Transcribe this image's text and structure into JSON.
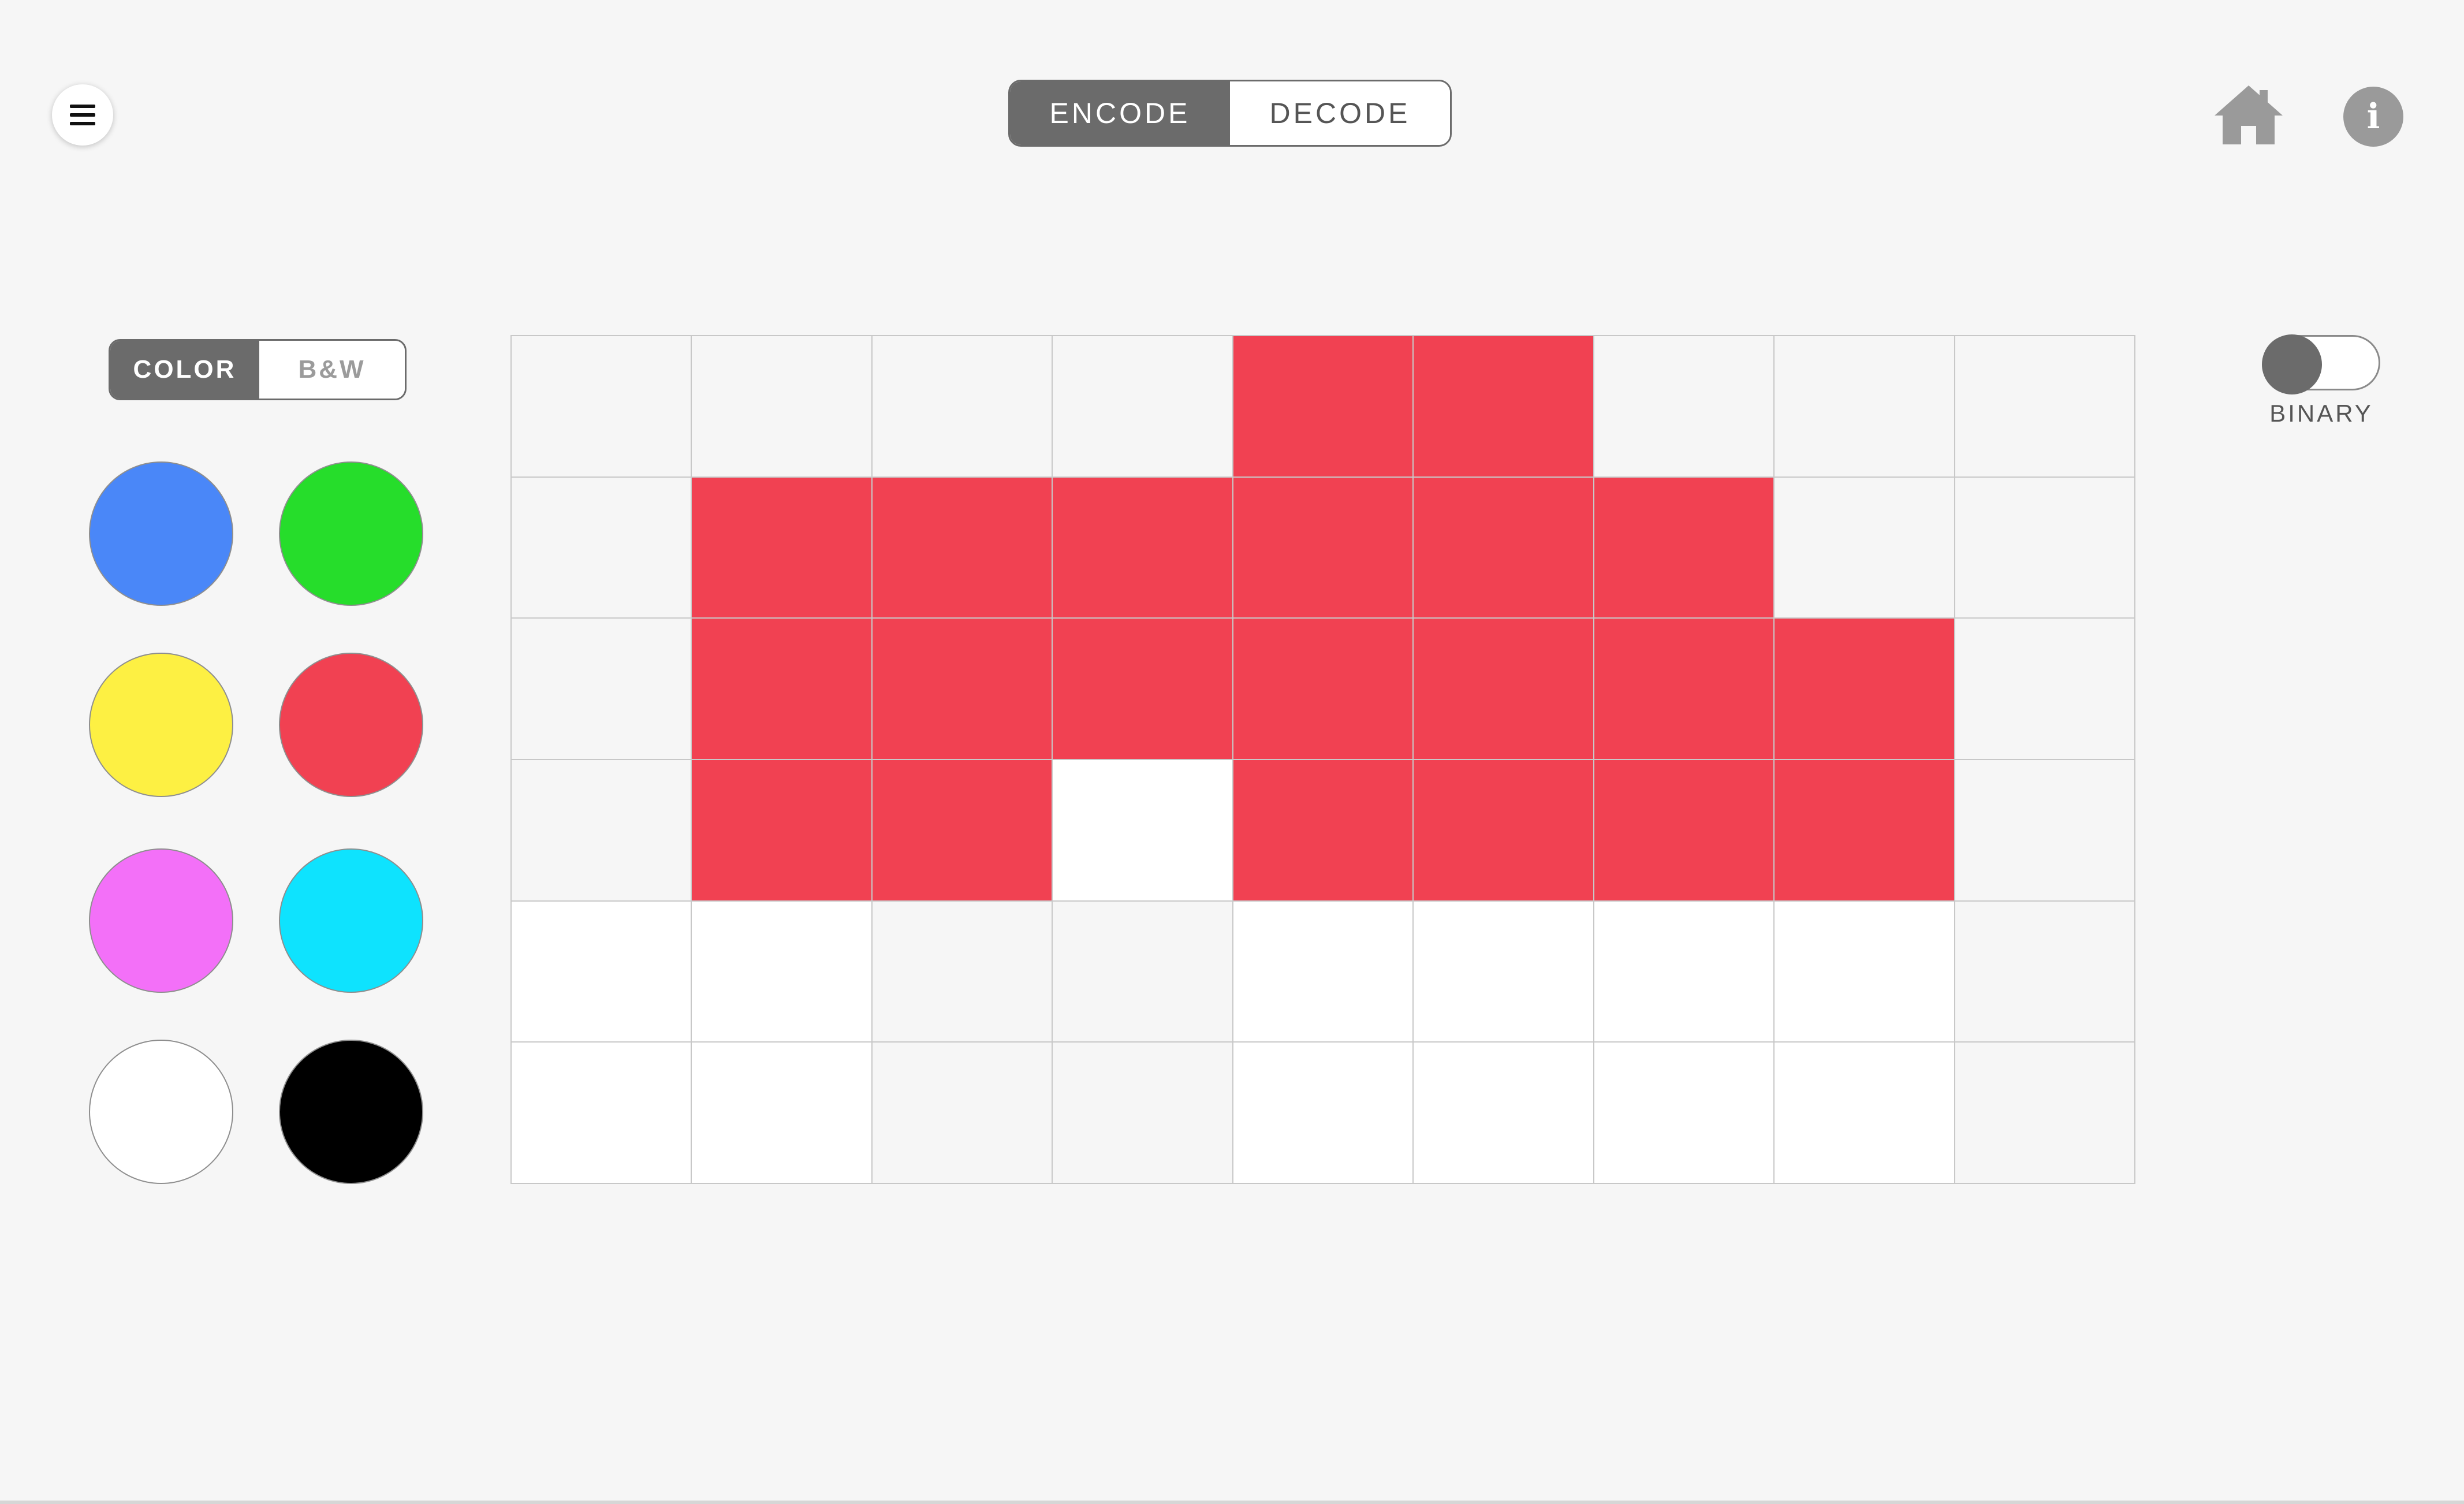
{
  "header": {
    "menu_icon": "hamburger-menu-icon",
    "mode_tabs": [
      {
        "label": "ENCODE",
        "active": true
      },
      {
        "label": "DECODE",
        "active": false
      }
    ],
    "home_icon": "home-icon",
    "info_icon": "info-icon",
    "info_glyph": "i"
  },
  "palette": {
    "mode_tabs": [
      {
        "label": "COLOR",
        "active": true
      },
      {
        "label": "B&W",
        "active": false
      }
    ],
    "swatches": [
      {
        "name": "blue",
        "color": "#4a87f8"
      },
      {
        "name": "green",
        "color": "#26dd2b"
      },
      {
        "name": "yellow",
        "color": "#fdf043"
      },
      {
        "name": "red",
        "color": "#f14152"
      },
      {
        "name": "magenta",
        "color": "#f370f8"
      },
      {
        "name": "cyan",
        "color": "#0ee3fe"
      },
      {
        "name": "white",
        "color": "#ffffff"
      },
      {
        "name": "black",
        "color": "#000000"
      }
    ]
  },
  "colors": {
    "empty_light": "#f6f6f6",
    "empty_white": "#ffffff",
    "red": "#f14152",
    "active_segment": "#6b6b6b"
  },
  "grid": {
    "columns": 9,
    "rows": 6,
    "cells": [
      [
        "empty_light",
        "empty_light",
        "empty_light",
        "empty_light",
        "red",
        "red",
        "empty_light",
        "empty_light",
        "empty_light"
      ],
      [
        "empty_light",
        "red",
        "red",
        "red",
        "red",
        "red",
        "red",
        "empty_light",
        "empty_light"
      ],
      [
        "empty_light",
        "red",
        "red",
        "red",
        "red",
        "red",
        "red",
        "red",
        "empty_light"
      ],
      [
        "empty_light",
        "red",
        "red",
        "empty_white",
        "red",
        "red",
        "red",
        "red",
        "empty_light"
      ],
      [
        "empty_white",
        "empty_white",
        "empty_light",
        "empty_light",
        "empty_white",
        "empty_white",
        "empty_white",
        "empty_white",
        "empty_light"
      ],
      [
        "empty_white",
        "empty_white",
        "empty_light",
        "empty_light",
        "empty_white",
        "empty_white",
        "empty_white",
        "empty_white",
        "empty_light"
      ]
    ]
  },
  "binary_toggle": {
    "label": "BINARY",
    "on": false
  }
}
